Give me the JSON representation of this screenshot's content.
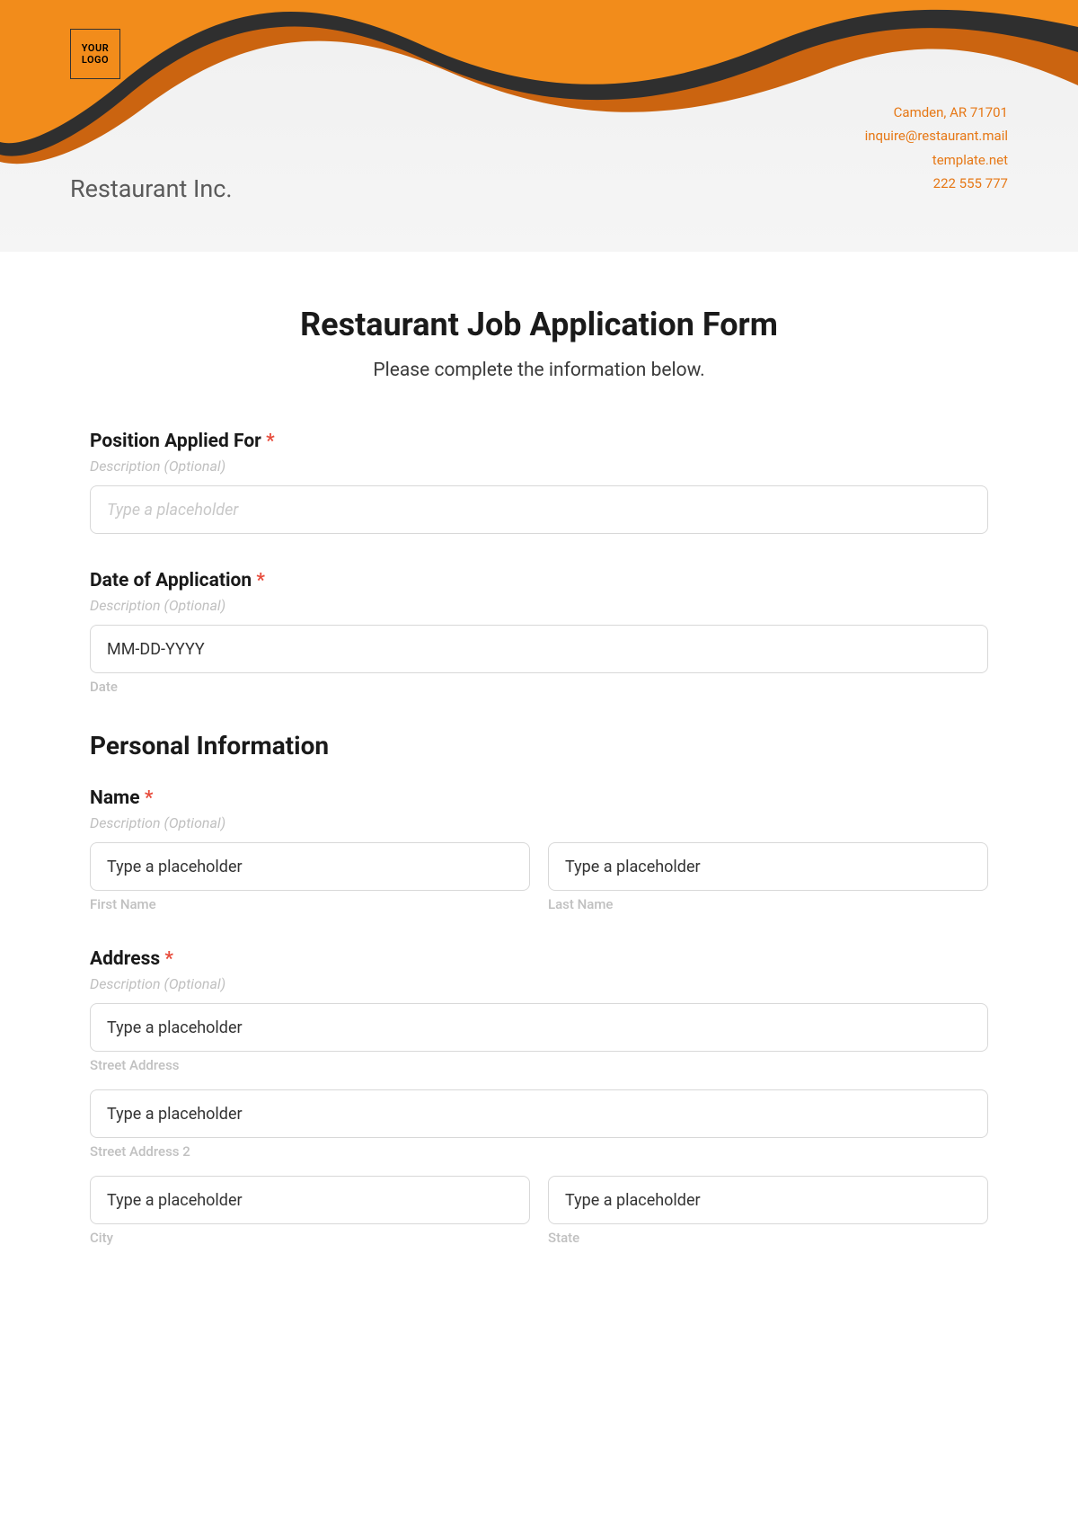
{
  "header": {
    "logo_text": "YOUR\nLOGO",
    "company": "Restaurant Inc.",
    "contact": {
      "address": "Camden, AR 71701",
      "email": "inquire@restaurant.mail",
      "site": "template.net",
      "phone": "222 555 777"
    }
  },
  "form": {
    "title": "Restaurant Job Application Form",
    "subtitle": "Please complete the information below.",
    "position": {
      "label": "Position Applied For",
      "desc": "Description (Optional)",
      "placeholder": "Type a placeholder"
    },
    "date": {
      "label": "Date of Application",
      "desc": "Description (Optional)",
      "placeholder": "MM-DD-YYYY",
      "sub": "Date"
    },
    "personal_heading": "Personal Information",
    "name": {
      "label": "Name",
      "desc": "Description (Optional)",
      "first_placeholder": "Type a placeholder",
      "last_placeholder": "Type a placeholder",
      "first_sub": "First Name",
      "last_sub": "Last Name"
    },
    "address": {
      "label": "Address",
      "desc": "Description (Optional)",
      "street_placeholder": "Type a placeholder",
      "street_sub": "Street Address",
      "street2_placeholder": "Type a placeholder",
      "street2_sub": "Street Address 2",
      "city_placeholder": "Type a placeholder",
      "city_sub": "City",
      "state_placeholder": "Type a placeholder",
      "state_sub": "State"
    },
    "required_mark": "*"
  }
}
